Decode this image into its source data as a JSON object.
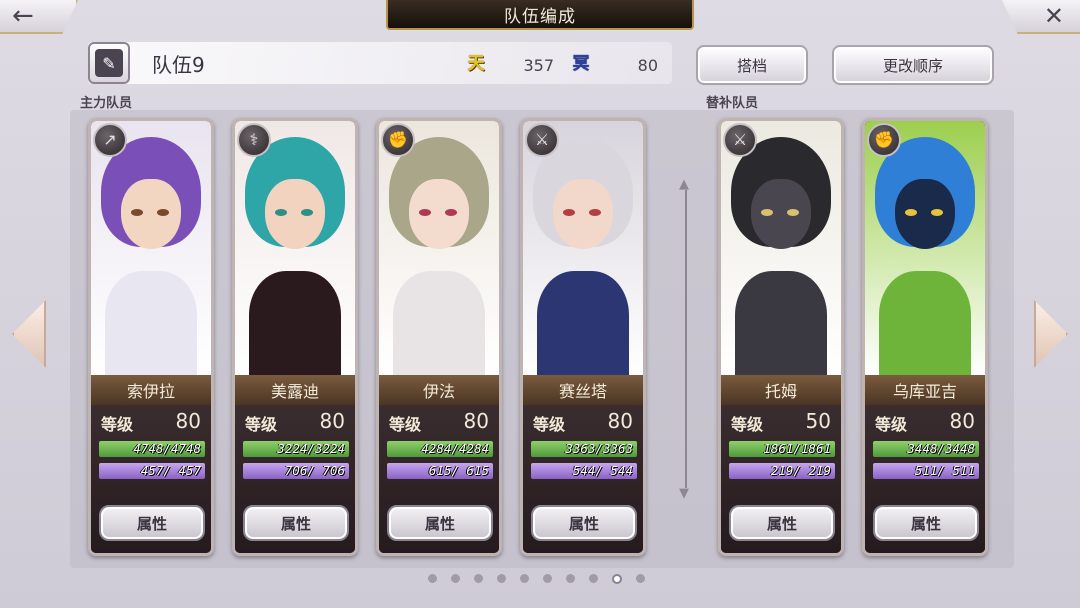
{
  "header": {
    "title": "队伍编成",
    "back_icon": "left-arrow-icon",
    "close_icon": "close-icon"
  },
  "team": {
    "name": "队伍9",
    "sun_label": "天",
    "sun_value": "357",
    "moon_label": "冥",
    "moon_value": "80",
    "partner_label": "搭档",
    "order_label": "更改顺序"
  },
  "sections": {
    "main": "主力队员",
    "sub": "替补队员"
  },
  "level_label": "等级",
  "attr_label": "属性",
  "members": [
    {
      "name": "索伊拉",
      "level": "80",
      "hp": "4748/4748",
      "mp": " 457/ 457",
      "weapon_icon": "spear-icon",
      "palette": {
        "bg": "#e9e4ef",
        "hair": "#7b4fb8",
        "face": "#f3d6c2",
        "body": "#e8e6f0",
        "eye": "#7a4a2a"
      }
    },
    {
      "name": "美露迪",
      "level": "80",
      "hp": "3224/3224",
      "mp": " 706/ 706",
      "weapon_icon": "staff-icon",
      "palette": {
        "bg": "#f0e8e6",
        "hair": "#2ea5a7",
        "face": "#f2d3c0",
        "body": "#2a1a1e",
        "eye": "#2e8f86"
      }
    },
    {
      "name": "伊法",
      "level": "80",
      "hp": "4284/4284",
      "mp": " 615/ 615",
      "weapon_icon": "gauntlet-icon",
      "palette": {
        "bg": "#ece6dd",
        "hair": "#a9a68a",
        "face": "#f3dccd",
        "body": "#e8e4e6",
        "eye": "#b03a55"
      }
    },
    {
      "name": "赛丝塔",
      "level": "80",
      "hp": "3363/3363",
      "mp": " 544/ 544",
      "weapon_icon": "sword-icon",
      "palette": {
        "bg": "#d8d4dc",
        "hair": "#d9d7dd",
        "face": "#f1d8ca",
        "body": "#2c3672",
        "eye": "#b24040"
      }
    },
    {
      "name": "托姆",
      "level": "50",
      "hp": "1861/1861",
      "mp": " 219/ 219",
      "weapon_icon": "sword-icon",
      "palette": {
        "bg": "#ece9e0",
        "hair": "#2a2a2e",
        "face": "#4a4650",
        "body": "#3a3840",
        "eye": "#d8c070"
      }
    },
    {
      "name": "乌库亚吉",
      "level": "80",
      "hp": "3448/3448",
      "mp": " 511/ 511",
      "weapon_icon": "gauntlet-icon",
      "palette": {
        "bg": "#9ccf4e",
        "hair": "#2f7fd6",
        "face": "#1a2a4a",
        "body": "#6fb43a",
        "eye": "#e8c23a"
      }
    }
  ],
  "pagination": {
    "count": 10,
    "active_index": 8
  }
}
